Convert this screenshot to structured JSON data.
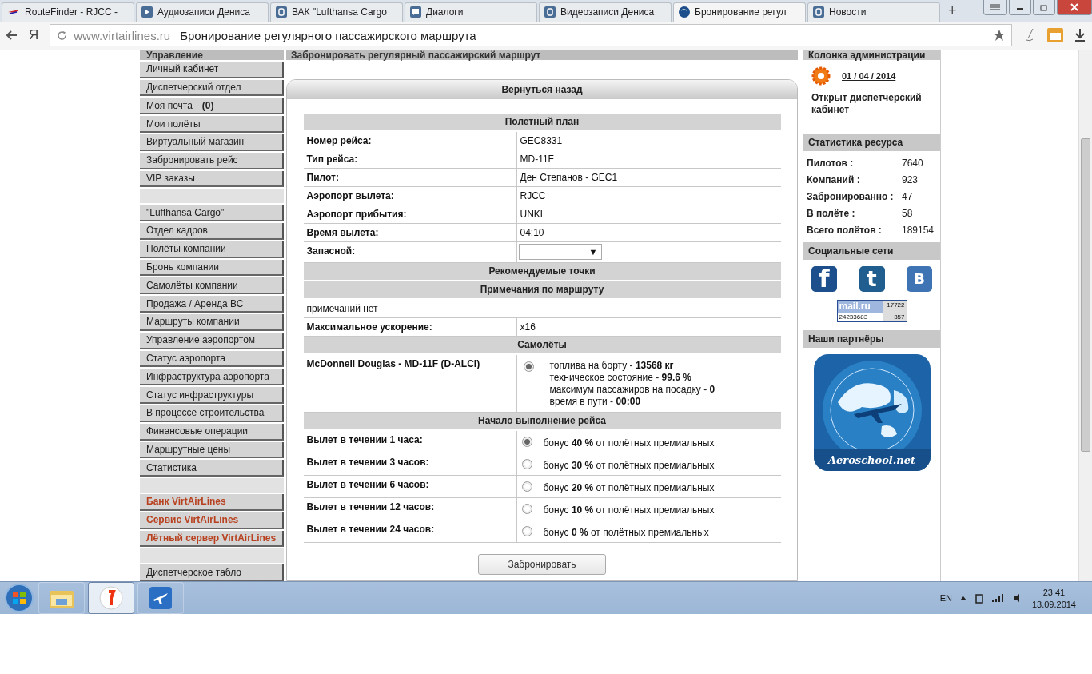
{
  "browser": {
    "tabs": [
      {
        "title": "RouteFinder - RJCC -",
        "kind": "route",
        "selected": false
      },
      {
        "title": "Аудиозаписи Дениса",
        "kind": "play",
        "selected": false
      },
      {
        "title": "ВАК \"Lufthansa Cargo",
        "kind": "vk",
        "selected": false
      },
      {
        "title": "Диалоги",
        "kind": "chat",
        "selected": false
      },
      {
        "title": "Видеозаписи Дениса",
        "kind": "vk",
        "selected": false
      },
      {
        "title": "Бронирование регул",
        "kind": "va",
        "selected": true
      },
      {
        "title": "Новости",
        "kind": "vk",
        "selected": false
      }
    ],
    "new_tab": "+",
    "yandex_button": "Я",
    "domain": "www.virtairlines.ru",
    "page_title": "Бронирование регулярного пассажирского маршрута"
  },
  "sidebar": {
    "title": "Управление",
    "groups": [
      [
        {
          "label": "Личный кабинет",
          "kind": "normal"
        },
        {
          "label": "Диспетчерский отдел",
          "kind": "normal"
        },
        {
          "label": "Моя почта",
          "badge": "(0)",
          "kind": "normal"
        },
        {
          "label": "Мои полёты",
          "kind": "normal"
        },
        {
          "label": "Виртуальный магазин",
          "kind": "normal"
        },
        {
          "label": "Забронировать рейс",
          "kind": "normal"
        },
        {
          "label": "VIP заказы",
          "kind": "normal"
        }
      ],
      [
        {
          "label": "\"Lufthansa Cargo\"",
          "kind": "normal"
        },
        {
          "label": "Отдел кадров",
          "kind": "normal"
        },
        {
          "label": "Полёты компании",
          "kind": "normal"
        },
        {
          "label": "Бронь компании",
          "kind": "normal"
        },
        {
          "label": "Самолёты компании",
          "kind": "normal"
        },
        {
          "label": "Продажа / Аренда ВС",
          "kind": "normal"
        },
        {
          "label": "Маршруты компании",
          "kind": "normal"
        },
        {
          "label": "Управление аэропортом",
          "kind": "normal"
        },
        {
          "label": "Статус аэропорта",
          "kind": "normal"
        },
        {
          "label": "Инфраструктура аэропорта",
          "kind": "normal"
        },
        {
          "label": "Статус инфраструктуры",
          "kind": "normal"
        },
        {
          "label": "В процессе строительства",
          "kind": "normal"
        },
        {
          "label": "Финансовые операции",
          "kind": "normal"
        },
        {
          "label": "Маршрутные цены",
          "kind": "normal"
        },
        {
          "label": "Статистика",
          "kind": "normal"
        }
      ],
      [
        {
          "label": "Банк VirtAirLines",
          "kind": "highlight"
        },
        {
          "label": "Сервис VirtAirLines",
          "kind": "highlight"
        },
        {
          "label": "Лётный сервер VirtAirLines",
          "kind": "highlight"
        }
      ],
      [
        {
          "label": "Диспетчерское табло",
          "kind": "normal"
        }
      ]
    ]
  },
  "main": {
    "title": "Забронировать регулярный пассажирский маршрут",
    "back_button": "Вернуться назад",
    "blocks": [
      {
        "kind": "header",
        "text": "Полетный план"
      },
      {
        "kind": "row",
        "label": "Номер рейса:",
        "value": "GEC8331"
      },
      {
        "kind": "row",
        "label": "Тип рейса:",
        "value": "MD-11F"
      },
      {
        "kind": "row",
        "label": "Пилот:",
        "value": "Ден Степанов - GEC1"
      },
      {
        "kind": "row",
        "label": "Аэропорт вылета:",
        "value": "RJCC"
      },
      {
        "kind": "row",
        "label": "Аэропорт прибытия:",
        "value": "UNKL"
      },
      {
        "kind": "row",
        "label": "Время вылета:",
        "value": "04:10"
      },
      {
        "kind": "select",
        "label": "Запасной:",
        "caret": "▼"
      },
      {
        "kind": "header",
        "text": "Рекомендуемые точки"
      },
      {
        "kind": "header",
        "text": "Примечания по маршруту"
      },
      {
        "kind": "note",
        "text": "примечаний нет"
      },
      {
        "kind": "row",
        "label": "Максимальное ускорение:",
        "value": "x16"
      },
      {
        "kind": "header",
        "text": "Самолёты"
      },
      {
        "kind": "aircraft",
        "label": "McDonnell Douglas - MD-11F (D-ALCI)",
        "selected": true,
        "details": [
          "топлива на борту - **13568 кг**",
          "техническое состояние - **99.6 %**",
          "максимум пассажиров на посадку - **0**",
          "время в пути - **00:00**"
        ]
      },
      {
        "kind": "header",
        "text": "Начало выполнение рейса"
      },
      {
        "kind": "option",
        "label": "Вылет в течении 1 часа:",
        "text": "бонус **40 %** от полётных премиальных",
        "selected": true
      },
      {
        "kind": "option",
        "label": "Вылет в течении 3 часов:",
        "text": "бонус **30 %** от полётных премиальных",
        "selected": false
      },
      {
        "kind": "option",
        "label": "Вылет в течении 6 часов:",
        "text": "бонус **20 %** от полётных премиальных",
        "selected": false
      },
      {
        "kind": "option",
        "label": "Вылет в течении 12 часов:",
        "text": "бонус **10 %** от полётных премиальных",
        "selected": false
      },
      {
        "kind": "option",
        "label": "Вылет в течении 24 часов:",
        "text": "бонус **0 %** от полётных премиальных",
        "selected": false
      }
    ],
    "book_button": "Забронировать"
  },
  "right": {
    "admin": {
      "title": "Колонка администрации",
      "date": "01 / 04 / 2014",
      "link": "Открыт диспетчерский кабинет"
    },
    "stats": {
      "title": "Статистика ресурса",
      "rows": [
        {
          "label": "Пилотов :",
          "value": "7640"
        },
        {
          "label": "Компаний :",
          "value": "923"
        },
        {
          "label": "Забронированно :",
          "value": "47"
        },
        {
          "label": "В полёте :",
          "value": "58"
        },
        {
          "label": "Всего полётов :",
          "value": "189154"
        }
      ]
    },
    "social": {
      "title": "Социальные сети",
      "networks": [
        {
          "kind": "facebook",
          "glyph": "f"
        },
        {
          "kind": "twitter",
          "glyph": "t"
        },
        {
          "kind": "vk",
          "glyph": "B"
        }
      ],
      "counter": {
        "logo": "mail.ru",
        "hits": "17722",
        "total": "24233683",
        "today": "357"
      }
    },
    "partners": {
      "title": "Наши партнёры",
      "name": "Aeroschool.net"
    }
  },
  "taskbar": {
    "apps": [
      {
        "kind": "folder",
        "selected": false
      },
      {
        "kind": "yandex",
        "selected": true
      },
      {
        "kind": "plane",
        "selected": false
      }
    ],
    "lang": "EN",
    "time": "23:41",
    "date": "13.09.2014"
  }
}
